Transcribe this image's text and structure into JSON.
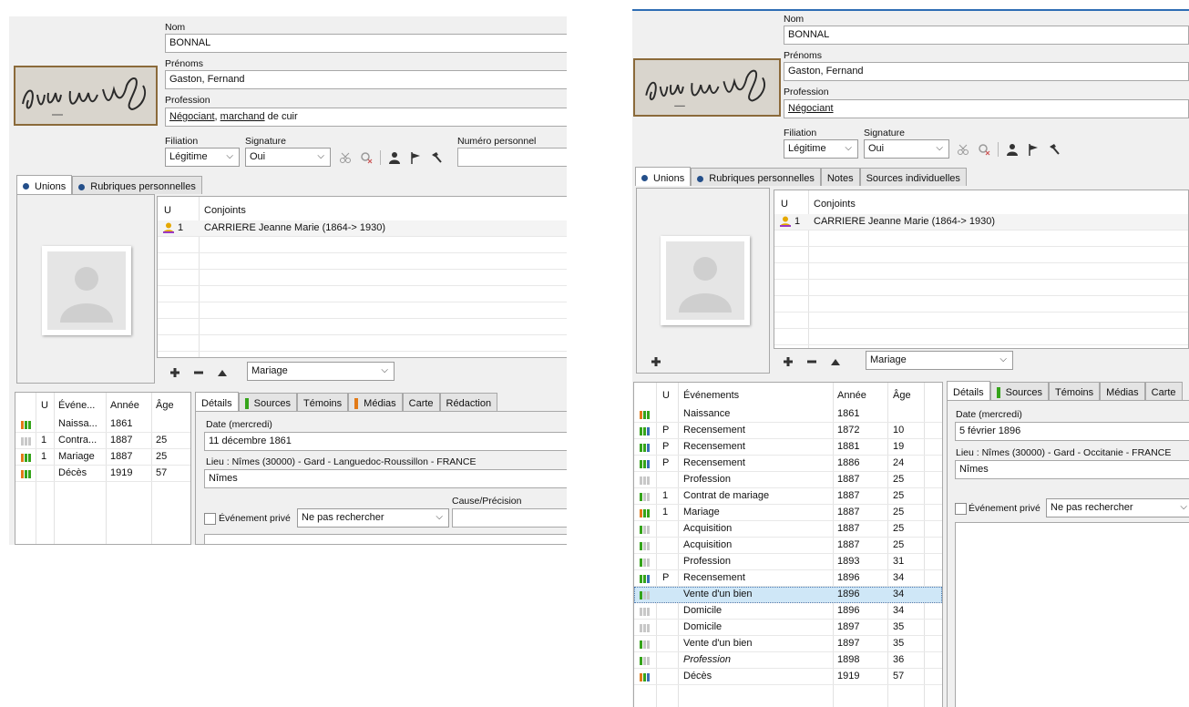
{
  "left": {
    "labels": {
      "nom": "Nom",
      "prenoms": "Prénoms",
      "profession": "Profession",
      "filiation": "Filiation",
      "signature": "Signature",
      "numero": "Numéro personnel",
      "date": "Date (mercredi)",
      "lieu": "Lieu : Nîmes (30000) - Gard - Languedoc-Roussillon - FRANCE",
      "cause": "Cause/Précision",
      "prive": "Événement privé"
    },
    "nom": "BONNAL",
    "prenoms": "Gaston, Fernand",
    "profession_parts": [
      "Négociant",
      ", ",
      "marchand",
      " de cuir"
    ],
    "filiation": "Légitime",
    "signature": "Oui",
    "tabs_top": [
      "Unions",
      "Rubriques personnelles"
    ],
    "conjoints_header": {
      "u": "U",
      "name": "Conjoints"
    },
    "conjoints": [
      {
        "u": "1",
        "name": "CARRIERE Jeanne Marie (1864-> 1930)"
      }
    ],
    "union_type": "Mariage",
    "events_header": {
      "u": "U",
      "name": "Événe...",
      "year": "Année",
      "age": "Âge"
    },
    "events": [
      {
        "bars": [
          "o",
          "g",
          "g"
        ],
        "u": "",
        "name": "Naissa...",
        "year": "1861",
        "age": ""
      },
      {
        "bars": [
          "x",
          "x",
          "x"
        ],
        "u": "1",
        "name": "Contra...",
        "year": "1887",
        "age": "25"
      },
      {
        "bars": [
          "o",
          "g",
          "g"
        ],
        "u": "1",
        "name": "Mariage",
        "year": "1887",
        "age": "25"
      },
      {
        "bars": [
          "o",
          "g",
          "g"
        ],
        "u": "",
        "name": "Décès",
        "year": "1919",
        "age": "57"
      }
    ],
    "detail_tabs": [
      "Détails",
      "Sources",
      "Témoins",
      "Médias",
      "Carte",
      "Rédaction"
    ],
    "date_value": "11 décembre 1861",
    "lieu_value": "Nîmes",
    "prive_select": "Ne pas rechercher"
  },
  "right": {
    "labels": {
      "nom": "Nom",
      "prenoms": "Prénoms",
      "profession": "Profession",
      "filiation": "Filiation",
      "signature": "Signature",
      "date": "Date (mercredi)",
      "lieu": "Lieu : Nîmes (30000) - Gard - Occitanie - FRANCE",
      "prive": "Événement privé"
    },
    "nom": "BONNAL",
    "prenoms": "Gaston, Fernand",
    "profession": "Négociant",
    "filiation": "Légitime",
    "signature": "Oui",
    "tabs_top": [
      "Unions",
      "Rubriques personnelles",
      "Notes",
      "Sources individuelles"
    ],
    "conjoints_header": {
      "u": "U",
      "name": "Conjoints"
    },
    "conjoints": [
      {
        "u": "1",
        "name": "CARRIERE Jeanne Marie (1864-> 1930)"
      }
    ],
    "union_type": "Mariage",
    "events_header": {
      "u": "U",
      "name": "Événements",
      "year": "Année",
      "age": "Âge"
    },
    "events": [
      {
        "bars": [
          "o",
          "g",
          "g"
        ],
        "u": "",
        "name": "Naissance",
        "year": "1861",
        "age": "",
        "italic": false
      },
      {
        "bars": [
          "g",
          "g",
          "b"
        ],
        "u": "P",
        "name": "Recensement",
        "year": "1872",
        "age": "10",
        "italic": false
      },
      {
        "bars": [
          "g",
          "g",
          "b"
        ],
        "u": "P",
        "name": "Recensement",
        "year": "1881",
        "age": "19",
        "italic": false
      },
      {
        "bars": [
          "g",
          "g",
          "b"
        ],
        "u": "P",
        "name": "Recensement",
        "year": "1886",
        "age": "24",
        "italic": false
      },
      {
        "bars": [
          "x",
          "x",
          "x"
        ],
        "u": "",
        "name": "Profession",
        "year": "1887",
        "age": "25",
        "italic": false
      },
      {
        "bars": [
          "g",
          "x",
          "x"
        ],
        "u": "1",
        "name": "Contrat de mariage",
        "year": "1887",
        "age": "25",
        "italic": false
      },
      {
        "bars": [
          "o",
          "g",
          "g"
        ],
        "u": "1",
        "name": "Mariage",
        "year": "1887",
        "age": "25",
        "italic": false
      },
      {
        "bars": [
          "g",
          "x",
          "x"
        ],
        "u": "",
        "name": "Acquisition",
        "year": "1887",
        "age": "25",
        "italic": false
      },
      {
        "bars": [
          "g",
          "x",
          "x"
        ],
        "u": "",
        "name": "Acquisition",
        "year": "1887",
        "age": "25",
        "italic": false
      },
      {
        "bars": [
          "g",
          "x",
          "x"
        ],
        "u": "",
        "name": "Profession",
        "year": "1893",
        "age": "31",
        "italic": false
      },
      {
        "bars": [
          "g",
          "g",
          "b"
        ],
        "u": "P",
        "name": "Recensement",
        "year": "1896",
        "age": "34",
        "italic": false
      },
      {
        "bars": [
          "g",
          "x",
          "x"
        ],
        "u": "",
        "name": "Vente d'un bien",
        "year": "1896",
        "age": "34",
        "italic": false,
        "selected": true
      },
      {
        "bars": [
          "x",
          "x",
          "x"
        ],
        "u": "",
        "name": "Domicile",
        "year": "1896",
        "age": "34",
        "italic": false
      },
      {
        "bars": [
          "x",
          "x",
          "x"
        ],
        "u": "",
        "name": "Domicile",
        "year": "1897",
        "age": "35",
        "italic": false
      },
      {
        "bars": [
          "g",
          "x",
          "x"
        ],
        "u": "",
        "name": "Vente d'un bien",
        "year": "1897",
        "age": "35",
        "italic": false
      },
      {
        "bars": [
          "g",
          "x",
          "x"
        ],
        "u": "",
        "name": "Profession",
        "year": "1898",
        "age": "36",
        "italic": true
      },
      {
        "bars": [
          "o",
          "g",
          "b"
        ],
        "u": "",
        "name": "Décès",
        "year": "1919",
        "age": "57",
        "italic": false
      }
    ],
    "detail_tabs": [
      "Détails",
      "Sources",
      "Témoins",
      "Médias",
      "Carte"
    ],
    "date_value": "5 février 1896",
    "lieu_value": "Nîmes",
    "prive_select": "Ne pas rechercher"
  },
  "colors": {
    "accent": "#2e6db4",
    "green": "#35a41a",
    "orange": "#e27a17",
    "blue": "#3a6fb5",
    "grey": "#c8c8c8",
    "selected": "#cfe7f7"
  }
}
